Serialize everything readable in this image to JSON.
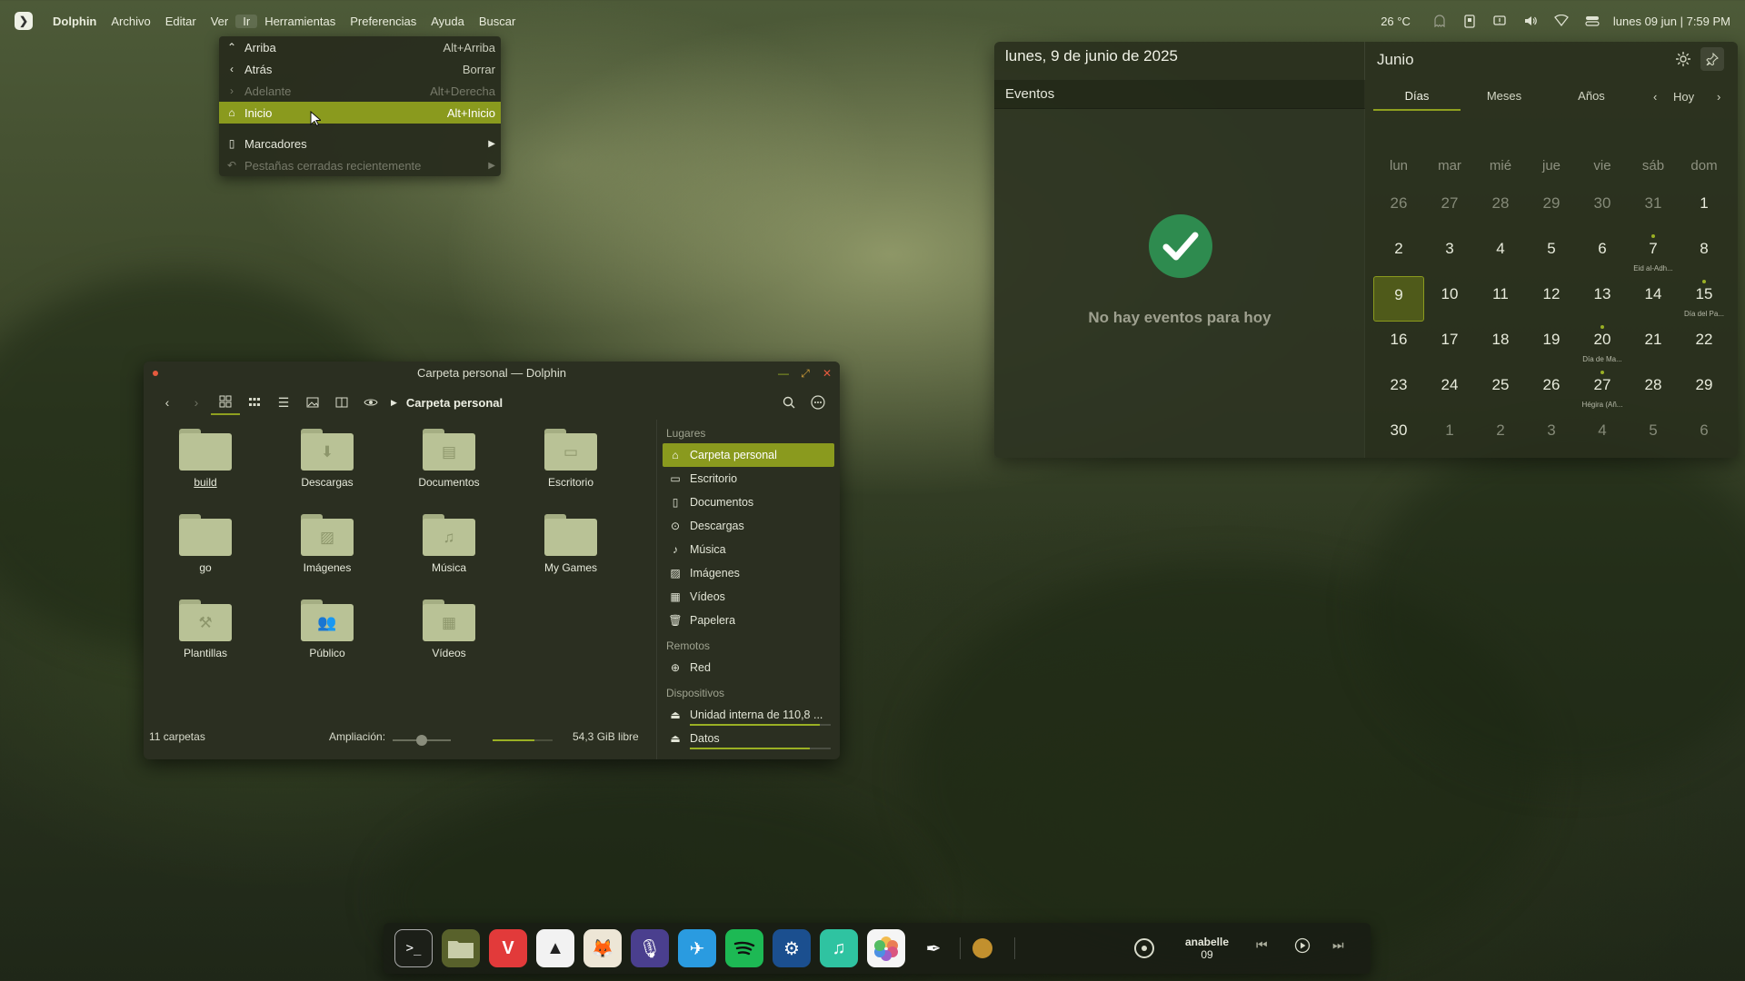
{
  "top_panel": {
    "app_name": "Dolphin",
    "menus": [
      "Archivo",
      "Editar",
      "Ver",
      "Ir",
      "Herramientas",
      "Preferencias",
      "Ayuda",
      "Buscar"
    ],
    "temperature": "26 °C",
    "clock": "lunes 09 jun | 7:59 PM"
  },
  "go_menu": {
    "items": [
      {
        "label": "Arriba",
        "shortcut": "Alt+Arriba",
        "icon": "chevron-up-icon"
      },
      {
        "label": "Atrás",
        "shortcut": "Borrar",
        "icon": "chevron-left-icon"
      },
      {
        "label": "Adelante",
        "shortcut": "Alt+Derecha",
        "icon": "chevron-right-icon"
      },
      {
        "label": "Inicio",
        "shortcut": "Alt+Inicio",
        "icon": "home-icon"
      },
      {
        "label": "Marcadores",
        "shortcut": "",
        "icon": "bookmark-icon"
      },
      {
        "label": "Pestañas cerradas recientemente",
        "shortcut": "",
        "icon": "undo-icon"
      }
    ]
  },
  "calendar": {
    "full_date": "lunes, 9 de junio de 2025",
    "events_header": "Eventos",
    "no_events": "No hay eventos para hoy",
    "month": "Junio",
    "tabs": [
      "Días",
      "Meses",
      "Años"
    ],
    "today_btn": "Hoy",
    "weekdays": [
      "lun",
      "mar",
      "mié",
      "jue",
      "vie",
      "sáb",
      "dom"
    ],
    "weeks": [
      [
        {
          "d": "26",
          "m": true
        },
        {
          "d": "27",
          "m": true
        },
        {
          "d": "28",
          "m": true
        },
        {
          "d": "29",
          "m": true
        },
        {
          "d": "30",
          "m": true
        },
        {
          "d": "31",
          "m": true
        },
        {
          "d": "1"
        }
      ],
      [
        {
          "d": "2"
        },
        {
          "d": "3"
        },
        {
          "d": "4"
        },
        {
          "d": "5"
        },
        {
          "d": "6"
        },
        {
          "d": "7",
          "ev": "Eid al-Adh..."
        },
        {
          "d": "8"
        }
      ],
      [
        {
          "d": "9",
          "today": true
        },
        {
          "d": "10"
        },
        {
          "d": "11"
        },
        {
          "d": "12"
        },
        {
          "d": "13"
        },
        {
          "d": "14"
        },
        {
          "d": "15",
          "ev": "Día del Pa..."
        }
      ],
      [
        {
          "d": "16"
        },
        {
          "d": "17"
        },
        {
          "d": "18"
        },
        {
          "d": "19"
        },
        {
          "d": "20",
          "ev": "Día de Ma..."
        },
        {
          "d": "21"
        },
        {
          "d": "22"
        }
      ],
      [
        {
          "d": "23"
        },
        {
          "d": "24"
        },
        {
          "d": "25"
        },
        {
          "d": "26"
        },
        {
          "d": "27",
          "ev": "Hégira (Añ..."
        },
        {
          "d": "28"
        },
        {
          "d": "29"
        }
      ],
      [
        {
          "d": "30"
        },
        {
          "d": "1",
          "m": true
        },
        {
          "d": "2",
          "m": true
        },
        {
          "d": "3",
          "m": true
        },
        {
          "d": "4",
          "m": true
        },
        {
          "d": "5",
          "m": true
        },
        {
          "d": "6",
          "m": true
        }
      ]
    ]
  },
  "dolphin": {
    "title": "Carpeta personal — Dolphin",
    "breadcrumb": "Carpeta personal",
    "files": [
      {
        "name": "build",
        "glyph": ""
      },
      {
        "name": "Descargas",
        "glyph": "⬇"
      },
      {
        "name": "Documentos",
        "glyph": "▤"
      },
      {
        "name": "Escritorio",
        "glyph": "▭"
      },
      {
        "name": "go",
        "glyph": ""
      },
      {
        "name": "Imágenes",
        "glyph": "▨"
      },
      {
        "name": "Música",
        "glyph": "♫"
      },
      {
        "name": "My Games",
        "glyph": ""
      },
      {
        "name": "Plantillas",
        "glyph": "⚒"
      },
      {
        "name": "Público",
        "glyph": "👥"
      },
      {
        "name": "Vídeos",
        "glyph": "▦"
      }
    ],
    "places_sections": [
      {
        "title": "Lugares",
        "items": [
          {
            "label": "Carpeta personal",
            "icon": "home-icon",
            "glyph": "⌂"
          },
          {
            "label": "Escritorio",
            "icon": "desktop-icon",
            "glyph": "▭"
          },
          {
            "label": "Documentos",
            "icon": "document-icon",
            "glyph": "▯"
          },
          {
            "label": "Descargas",
            "icon": "download-icon",
            "glyph": "⊙"
          },
          {
            "label": "Música",
            "icon": "music-icon",
            "glyph": "♪"
          },
          {
            "label": "Imágenes",
            "icon": "image-icon",
            "glyph": "▨"
          },
          {
            "label": "Vídeos",
            "icon": "video-icon",
            "glyph": "▦"
          },
          {
            "label": "Papelera",
            "icon": "trash-icon",
            "glyph": "🗑"
          }
        ]
      },
      {
        "title": "Remotos",
        "items": [
          {
            "label": "Red",
            "icon": "network-icon",
            "glyph": "⊕"
          }
        ]
      },
      {
        "title": "Dispositivos",
        "items": [
          {
            "label": "Unidad interna de 110,8 ...",
            "icon": "drive-icon",
            "glyph": "⏏",
            "usage": 0.92
          },
          {
            "label": "Datos",
            "icon": "drive-icon",
            "glyph": "⏏",
            "usage": 0.85
          }
        ]
      }
    ],
    "status_count": "11 carpetas",
    "zoom_label": "Ampliación:",
    "free_space": "54,3 GiB libre"
  },
  "dock": {
    "user_name": "anabelle",
    "user_sub": "09"
  },
  "colors": {
    "accent": "#8a9a1e",
    "folder": "#b9c296",
    "check": "#2e8b4f"
  }
}
